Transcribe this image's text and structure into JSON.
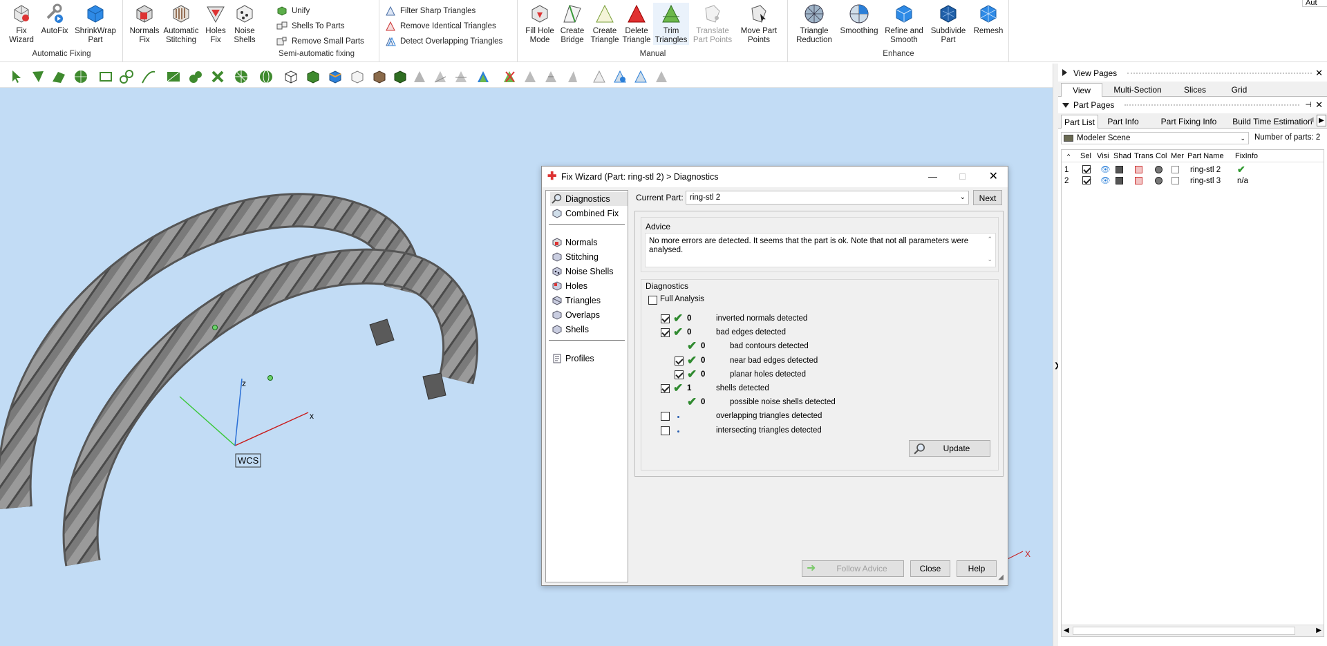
{
  "ribbon": {
    "automatic_fixing": {
      "group_label": "Automatic Fixing",
      "buttons": [
        {
          "label1": "Fix",
          "label2": "Wizard",
          "icon": "fix-wizard-icon"
        },
        {
          "label1": "AutoFix",
          "label2": "",
          "icon": "autofix-icon"
        },
        {
          "label1": "ShrinkWrap",
          "label2": "Part",
          "icon": "shrinkwrap-icon"
        }
      ]
    },
    "semi_automatic": {
      "group_label": "Semi-automatic fixing",
      "buttons": [
        {
          "label1": "Normals",
          "label2": "Fix"
        },
        {
          "label1": "Automatic",
          "label2": "Stitching"
        },
        {
          "label1": "Holes",
          "label2": "Fix"
        },
        {
          "label1": "Noise",
          "label2": "Shells"
        }
      ],
      "small": [
        "Unify",
        "Shells To Parts",
        "Remove Small Parts"
      ]
    },
    "triangles": {
      "small": [
        "Filter Sharp Triangles",
        "Remove Identical Triangles",
        "Detect Overlapping Triangles"
      ]
    },
    "manual": {
      "group_label": "Manual",
      "buttons": [
        {
          "label1": "Fill Hole",
          "label2": "Mode"
        },
        {
          "label1": "Create",
          "label2": "Bridge"
        },
        {
          "label1": "Create",
          "label2": "Triangle"
        },
        {
          "label1": "Delete",
          "label2": "Triangle"
        },
        {
          "label1": "Trim",
          "label2": "Triangles"
        },
        {
          "label1": "Translate",
          "label2": "Part Points"
        },
        {
          "label1": "Move Part",
          "label2": "Points"
        }
      ]
    },
    "enhance": {
      "group_label": "Enhance",
      "buttons": [
        {
          "label1": "Triangle",
          "label2": "Reduction"
        },
        {
          "label1": "Smoothing",
          "label2": ""
        },
        {
          "label1": "Refine and",
          "label2": "Smooth"
        },
        {
          "label1": "Subdivide",
          "label2": "Part"
        },
        {
          "label1": "Remesh",
          "label2": ""
        }
      ]
    },
    "corner_text": "Aut"
  },
  "viewport": {
    "wcs_label": "WCS",
    "axis_x": "x",
    "axis_z": "z",
    "axis_marker": "X",
    "colors": {
      "background": "#c2dcf5",
      "x_axis": "#c81e1e",
      "y_axis": "#3cc83c",
      "z_axis": "#2a6fd6"
    }
  },
  "right_panel": {
    "view_pages": {
      "title": "View Pages",
      "tabs": [
        "View",
        "Multi-Section",
        "Slices",
        "Grid"
      ]
    },
    "part_pages": {
      "title": "Part Pages",
      "tabs": [
        "Part List",
        "Part Info",
        "Part Fixing Info",
        "Build Time Estimation"
      ],
      "scene_select": "Modeler Scene",
      "num_parts_label": "Number of parts:",
      "num_parts_value": "2",
      "columns": [
        "Sel",
        "Visi",
        "Shad",
        "Trans",
        "Col",
        "Mer",
        "Part Name",
        "FixInfo"
      ],
      "rows": [
        {
          "index": "1",
          "name": "ring-stl 2",
          "fixinfo": ""
        },
        {
          "index": "2",
          "name": "ring-stl 3",
          "fixinfo": "n/a"
        }
      ]
    }
  },
  "dialog": {
    "title": "Fix Wizard (Part: ring-stl 2) > Diagnostics",
    "nav": {
      "top": [
        "Diagnostics",
        "Combined Fix"
      ],
      "mid": [
        "Normals",
        "Stitching",
        "Noise Shells",
        "Holes",
        "Triangles",
        "Overlaps",
        "Shells"
      ],
      "bottom": [
        "Profiles"
      ]
    },
    "current_part_label": "Current Part:",
    "current_part_value": "ring-stl 2",
    "next_label": "Next",
    "advice_title": "Advice",
    "advice_text": "No more errors are detected. It seems that the part is ok. Note that not all parameters were analysed.",
    "diagnostics_title": "Diagnostics",
    "full_analysis_label": "Full Analysis",
    "rows": [
      {
        "count": "0",
        "label": "inverted normals detected",
        "level": 0,
        "checked": true,
        "ok": true
      },
      {
        "count": "0",
        "label": "bad edges detected",
        "level": 0,
        "checked": true,
        "ok": true
      },
      {
        "count": "0",
        "label": "bad contours detected",
        "level": 1,
        "checked": null,
        "ok": true
      },
      {
        "count": "0",
        "label": "near bad edges detected",
        "level": 1,
        "checked": true,
        "ok": true
      },
      {
        "count": "0",
        "label": "planar holes detected",
        "level": 1,
        "checked": true,
        "ok": true
      },
      {
        "count": "1",
        "label": "shells detected",
        "level": 0,
        "checked": true,
        "ok": true
      },
      {
        "count": "0",
        "label": "possible noise shells detected",
        "level": 1,
        "checked": null,
        "ok": true
      },
      {
        "count": "",
        "label": "overlapping triangles detected",
        "level": 0,
        "checked": false,
        "ok": false
      },
      {
        "count": "",
        "label": "intersecting triangles detected",
        "level": 0,
        "checked": false,
        "ok": false
      }
    ],
    "update_label": "Update",
    "follow_advice_label": "Follow Advice",
    "close_label": "Close",
    "help_label": "Help"
  }
}
